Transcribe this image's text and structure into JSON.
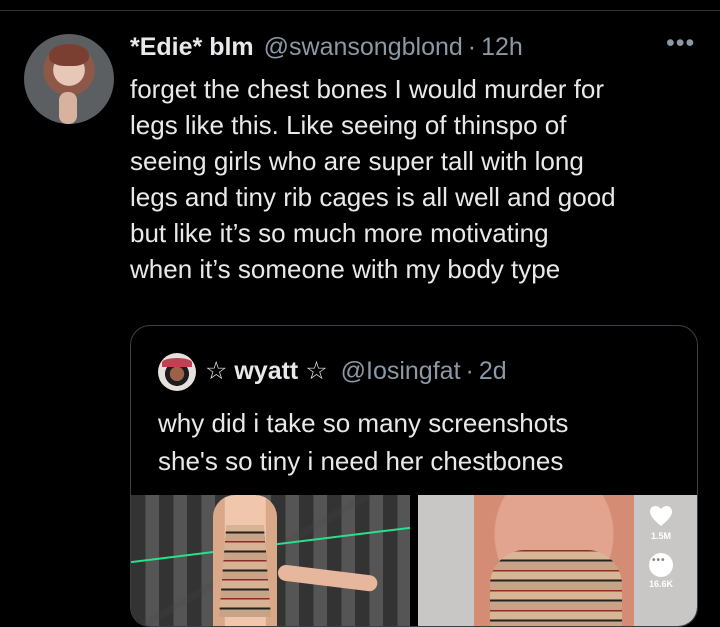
{
  "tweet": {
    "display_name": "*Edie* blm",
    "handle": "@swansongblond",
    "separator": "·",
    "timestamp": "12h",
    "more": "•••",
    "text": "forget the chest bones I would murder for\nlegs like this. Like seeing of thinspo of\nseeing girls who are super tall with long\nlegs and tiny rib cages is all well and good\nbut like it’s so much more motivating\nwhen it’s someone with my body type"
  },
  "quote": {
    "display_name": "☆ wyatt ☆",
    "handle": "@Iosingfat",
    "separator": "·",
    "timestamp": "2d",
    "text": "why did i take so many screenshots\nshe's so tiny i need her chestbones",
    "media": {
      "like_count": "1.5M",
      "comment_count": "16.6K"
    }
  },
  "icons": {
    "more": "more-icon",
    "heart": "heart-icon",
    "comment": "comment-icon"
  }
}
